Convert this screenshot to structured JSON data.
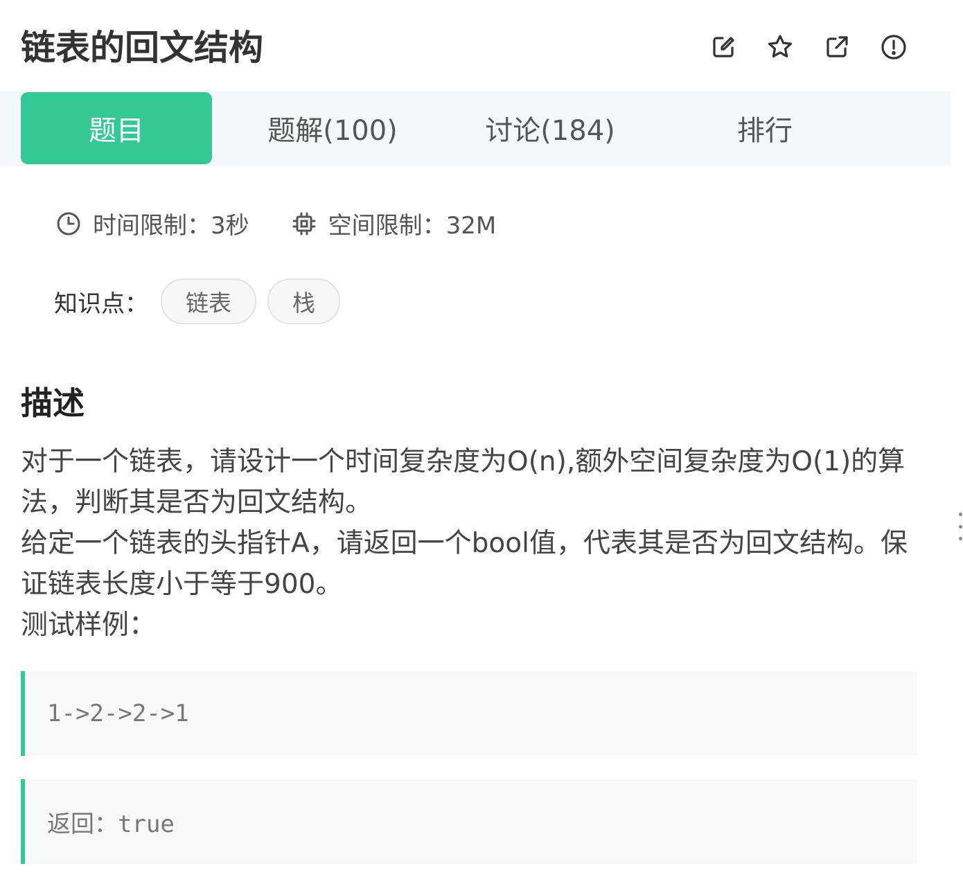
{
  "header": {
    "title": "链表的回文结构",
    "icons": [
      "edit-icon",
      "star-icon",
      "external-link-icon",
      "report-icon"
    ]
  },
  "tabs": [
    {
      "label": "题目",
      "active": true
    },
    {
      "label": "题解(100)",
      "active": false
    },
    {
      "label": "讨论(184)",
      "active": false
    },
    {
      "label": "排行",
      "active": false
    }
  ],
  "limits": {
    "time": "时间限制：3秒",
    "memory": "空间限制：32M"
  },
  "tags": {
    "label": "知识点：",
    "items": [
      "链表",
      "栈"
    ]
  },
  "description": {
    "heading": "描述",
    "paragraphs": [
      "对于一个链表，请设计一个时间复杂度为O(n),额外空间复杂度为O(1)的算法，判断其是否为回文结构。",
      "给定一个链表的头指针A，请返回一个bool值，代表其是否为回文结构。保证链表长度小于等于900。",
      "测试样例："
    ]
  },
  "examples": {
    "input": "1->2->2->1",
    "output": "返回：true"
  },
  "colors": {
    "accent": "#32c995",
    "tab_bar_bg": "#f6f7f8",
    "code_bg": "#f8f8f8"
  }
}
